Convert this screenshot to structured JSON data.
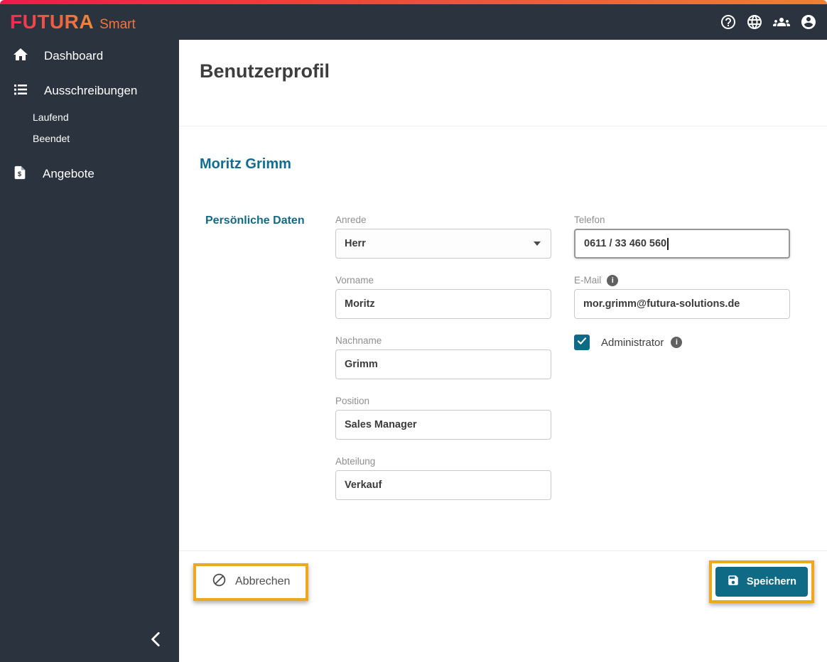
{
  "app": {
    "brand": "FUTURA",
    "brand_suffix": "Smart"
  },
  "topbar": {
    "icons": [
      "help-icon",
      "language-icon",
      "groups-icon",
      "account-icon"
    ]
  },
  "sidebar": {
    "items": [
      {
        "label": "Dashboard",
        "icon": "home-icon"
      },
      {
        "label": "Ausschreibungen",
        "icon": "list-icon"
      },
      {
        "label": "Laufend"
      },
      {
        "label": "Beendet"
      },
      {
        "label": "Angebote",
        "icon": "quote-icon"
      }
    ],
    "collapse_icon": "chevron-left-icon"
  },
  "page": {
    "title": "Benutzerprofil",
    "user_name": "Moritz Grimm",
    "section_title": "Persönliche Daten"
  },
  "form": {
    "fields_left": [
      {
        "label": "Anrede",
        "value": "Herr",
        "type": "select"
      },
      {
        "label": "Vorname",
        "value": "Moritz",
        "type": "text"
      },
      {
        "label": "Nachname",
        "value": "Grimm",
        "type": "text"
      },
      {
        "label": "Position",
        "value": "Sales Manager",
        "type": "text"
      },
      {
        "label": "Abteilung",
        "value": "Verkauf",
        "type": "text"
      }
    ],
    "fields_right": [
      {
        "label": "Telefon",
        "value": "0611 / 33 460 560",
        "type": "text",
        "focused": true
      },
      {
        "label": "E-Mail",
        "value": "mor.grimm@futura-solutions.de",
        "type": "text",
        "info": true
      }
    ],
    "checkbox": {
      "label": "Administrator",
      "checked": true,
      "info": true
    }
  },
  "actions": {
    "cancel_label": "Abbrechen",
    "save_label": "Speichern"
  },
  "colors": {
    "navy": "#2a333e",
    "teal": "#0e6a85",
    "heading_teal": "#0f6d90",
    "highlight_orange": "#eda81f",
    "strip_gradient_start": "#ec1c4c",
    "strip_gradient_end": "#f0802e"
  }
}
